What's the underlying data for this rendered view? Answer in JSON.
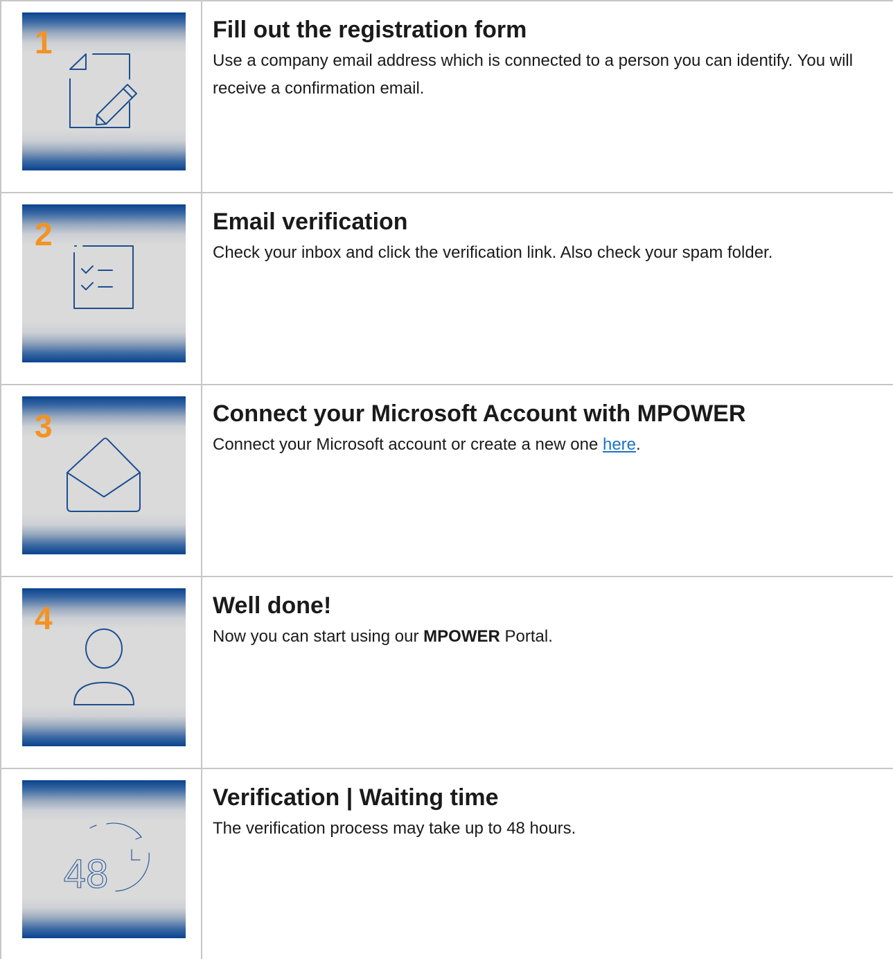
{
  "colors": {
    "accent_orange": "#f39322",
    "brand_blue": "#08438f",
    "tile_grey": "#dadada",
    "icon_blue": "#1d4e8f",
    "link_blue": "#1a73c8"
  },
  "steps": [
    {
      "number": "1",
      "icon": "document-edit-icon",
      "title": "Fill out the registration form",
      "description": "Use a company email address which is connected to a person you can identify. You will receive a confirmation email."
    },
    {
      "number": "2",
      "icon": "checklist-icon",
      "title": "Email verification",
      "description": "Check your inbox and click the verification link. Also check your spam folder."
    },
    {
      "number": "3",
      "icon": "open-envelope-icon",
      "title": "Connect your Microsoft Account with MPOWER",
      "description_before": "Connect your Microsoft account or create a new one ",
      "link_text": "here",
      "description_after": "."
    },
    {
      "number": "4",
      "icon": "user-icon",
      "title": "Well done!",
      "description_before": "Now you can start using our ",
      "description_bold": "MPOWER",
      "description_after": " Portal."
    },
    {
      "icon_text": "48",
      "icon": "48-hour-clock-icon",
      "title": "Verification | Waiting time",
      "description": "The verification process may take up to 48 hours."
    }
  ]
}
